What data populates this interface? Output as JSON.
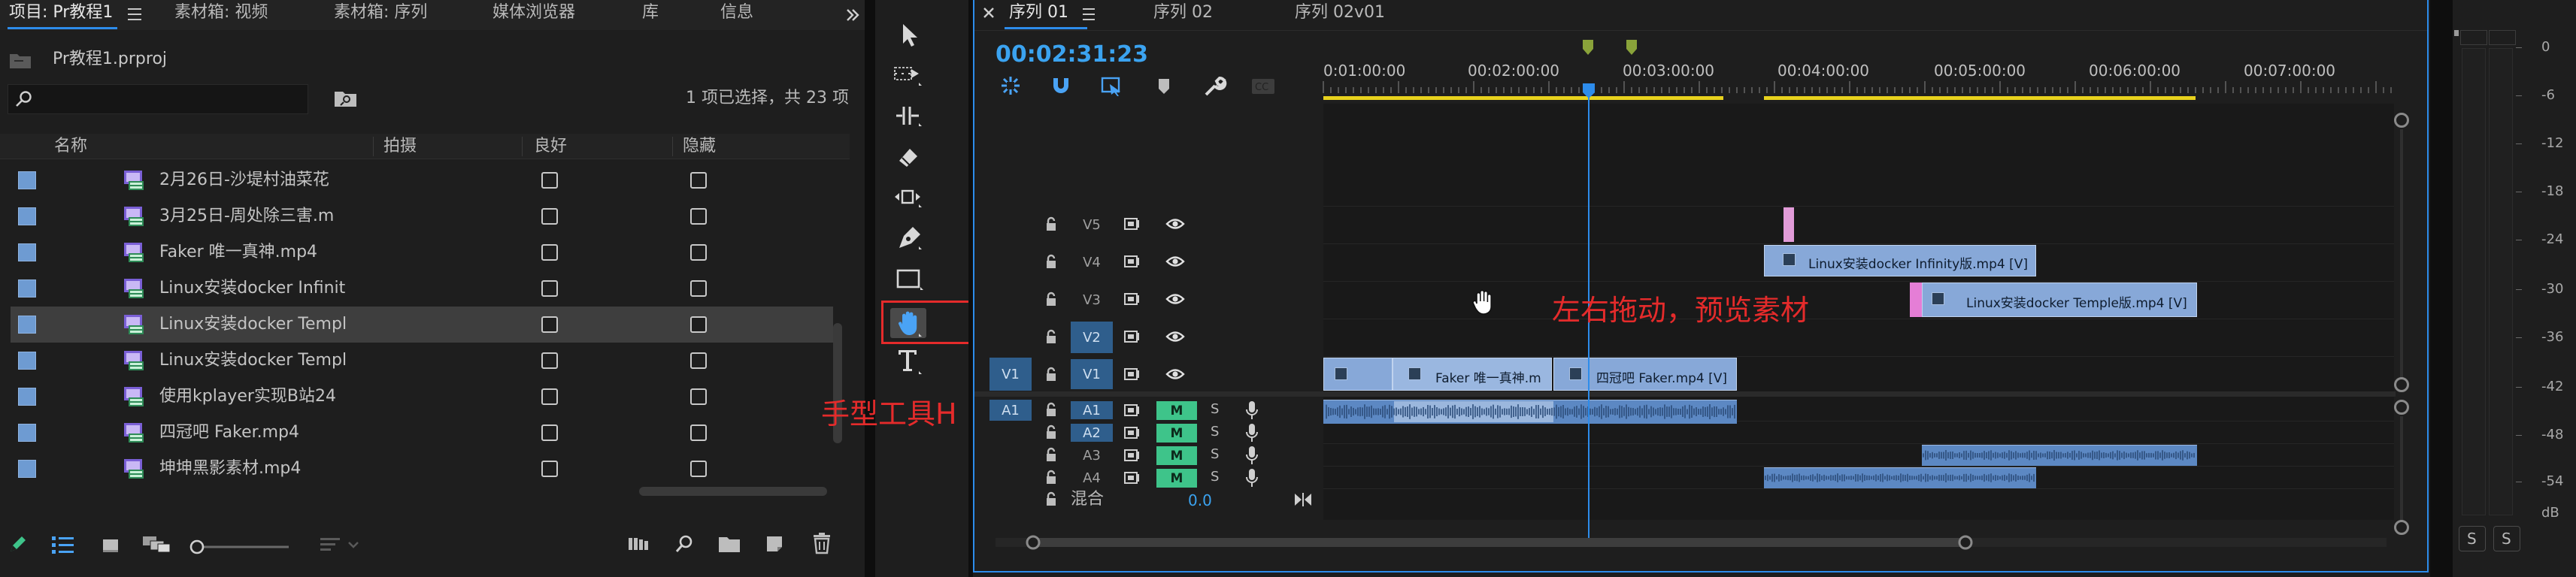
{
  "project_panel": {
    "tabs": [
      "项目: Pr教程1",
      "素材箱: 视频",
      "素材箱: 序列",
      "媒体浏览器",
      "库",
      "信息"
    ],
    "project_file": "Pr教程1.prproj",
    "selection_status": "1 项已选择，共 23 项",
    "search_placeholder": "",
    "columns": [
      "名称",
      "拍摄",
      "良好",
      "隐藏"
    ],
    "items": [
      {
        "name": "2月26日-沙堤村油菜花",
        "selected": false
      },
      {
        "name": "3月25日-周处除三害.m",
        "selected": false
      },
      {
        "name": "Faker 唯一真神.mp4",
        "selected": false
      },
      {
        "name": "Linux安装docker Infinit",
        "selected": false
      },
      {
        "name": "Linux安装docker Templ",
        "selected": true
      },
      {
        "name": "Linux安装docker Templ",
        "selected": false
      },
      {
        "name": "使用kplayer实现B站24",
        "selected": false
      },
      {
        "name": "四冠吧 Faker.mp4",
        "selected": false
      },
      {
        "name": "坤坤黑影素材.mp4",
        "selected": false
      }
    ]
  },
  "tools": {
    "selected_tool": "hand-tool",
    "annotation": "手型工具H"
  },
  "timeline": {
    "tabs": [
      "序列 01",
      "序列 02",
      "序列 02v01"
    ],
    "active_tab": "序列 01",
    "timecode": "00:02:31:23",
    "ruler_labels": [
      "0:01:00:00",
      "00:02:00:00",
      "00:03:00:00",
      "00:04:00:00",
      "00:05:00:00",
      "00:06:00:00",
      "00:07:00:00"
    ],
    "video_tracks": [
      "V5",
      "V4",
      "V3",
      "V2",
      "V1"
    ],
    "audio_tracks": [
      "A1",
      "A2",
      "A3",
      "A4"
    ],
    "source_video": "V1",
    "source_audio": "A1",
    "mute_label": "M",
    "solo_label": "S",
    "mix_label": "混合",
    "mix_value": "0.0",
    "clips": {
      "v4": "Linux安装docker Infinity版.mp4 [V]",
      "v3": "Linux安装docker Temple版.mp4 [V]",
      "v1a": "Faker 唯一真神.m",
      "v1b": "四冠吧 Faker.mp4 [V]"
    },
    "annotation": "左右拖动，预览素材"
  },
  "audio_meter": {
    "scale": [
      "0",
      "-6",
      "-12",
      "-18",
      "-24",
      "-30",
      "-36",
      "-42",
      "-48",
      "-54",
      "dB"
    ],
    "solo_labels": [
      "S",
      "S"
    ]
  },
  "colors": {
    "accent_blue": "#2d8ceb",
    "timecode_blue": "#3ba3f0",
    "annotation_red": "#e52b2b",
    "work_area_yellow": "#e8d21d"
  }
}
